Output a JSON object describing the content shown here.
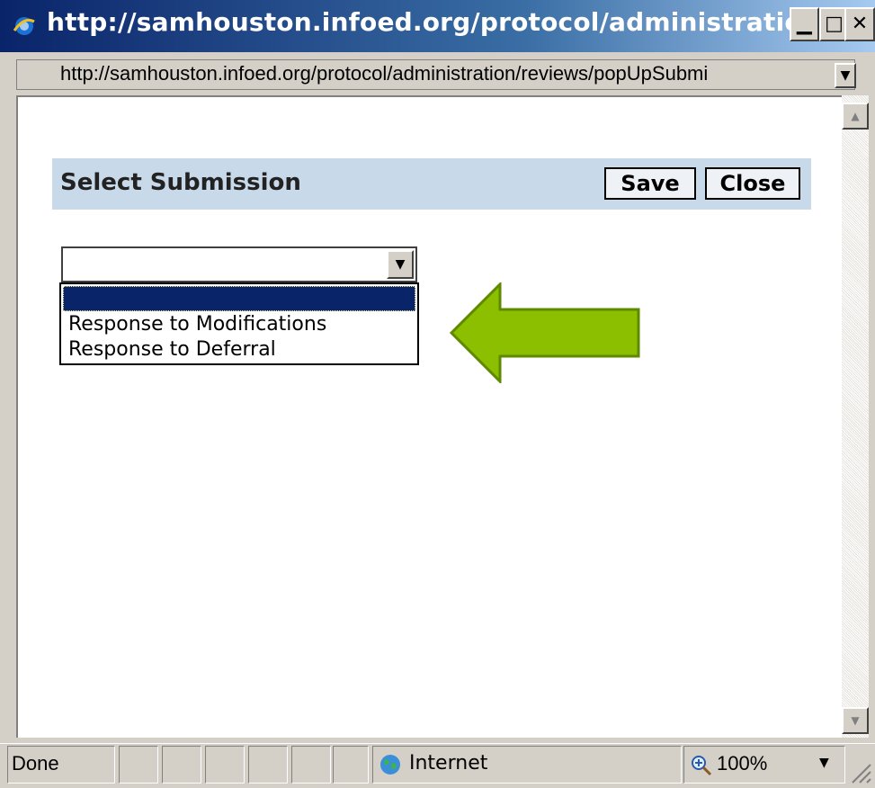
{
  "window": {
    "title": "http://samhouston.infoed.org/protocol/administration/rev...",
    "min_glyph": "▁",
    "max_glyph": "□",
    "close_glyph": "✕"
  },
  "address": {
    "url": "http://samhouston.infoed.org/protocol/administration/reviews/popUpSubmi",
    "dropdown_glyph": "▼"
  },
  "dialog": {
    "title": "Select Submission",
    "save_label": "Save",
    "close_label": "Close",
    "select": {
      "selected_value": "",
      "arrow_glyph": "▼",
      "options": [
        "",
        "Response to Modifications",
        "Response to Deferral"
      ]
    }
  },
  "annotation": {
    "arrow_color": "#8cbf00"
  },
  "scrollbar": {
    "up_glyph": "▲",
    "down_glyph": "▼"
  },
  "status": {
    "text": "Done",
    "zone": "Internet",
    "zoom": "100%",
    "zoom_dropdown_glyph": "▼"
  }
}
